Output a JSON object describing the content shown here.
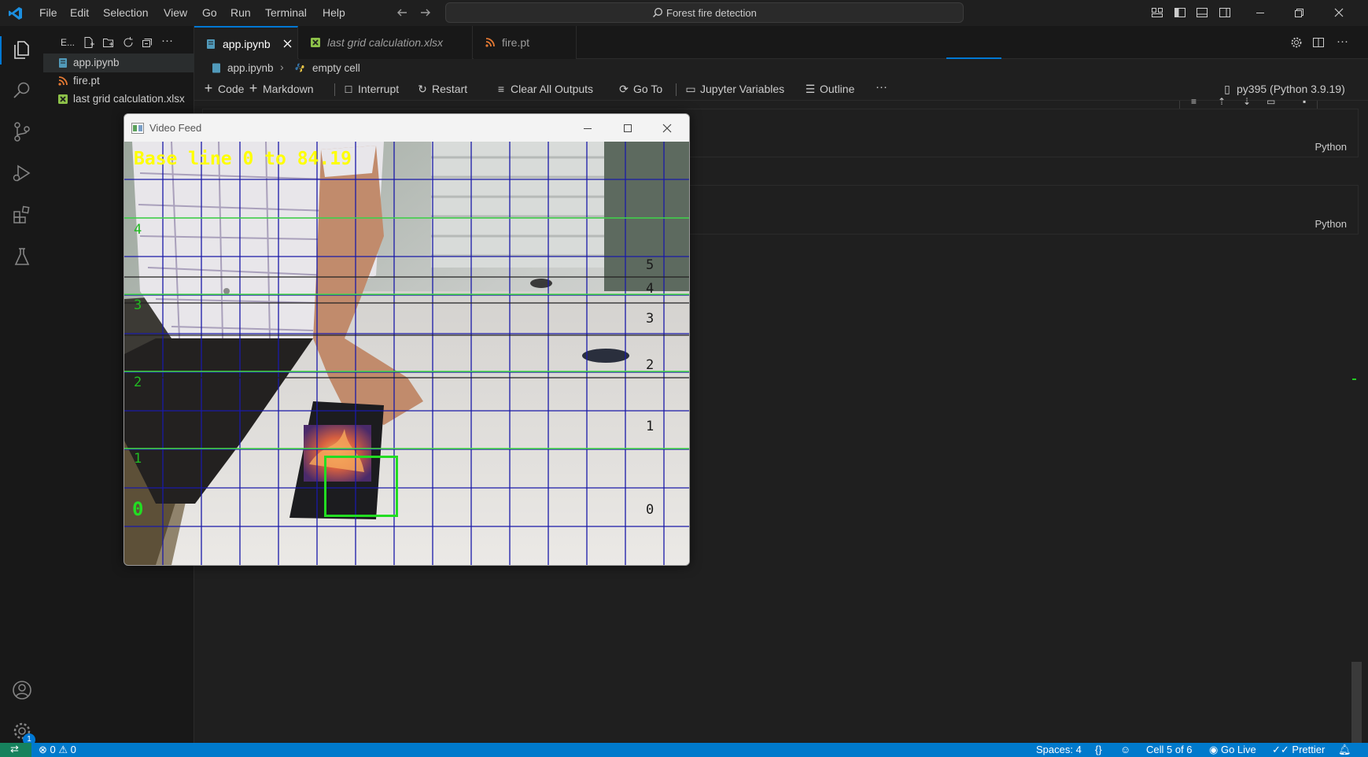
{
  "colors": {
    "accent": "#0078d4",
    "status_bar": "#007acc",
    "detect_box": "#22dd22",
    "overlay_text": "#ffff00"
  },
  "menu": [
    "File",
    "Edit",
    "Selection",
    "View",
    "Go",
    "Run",
    "Terminal",
    "Help"
  ],
  "search": {
    "text": "Forest fire detection",
    "icon": "search-icon"
  },
  "explorer": {
    "title": "E...",
    "files": [
      {
        "name": "app.ipynb",
        "icon": "notebook-icon"
      },
      {
        "name": "fire.pt",
        "icon": "rss-file-icon"
      },
      {
        "name": "last grid calculation.xlsx",
        "icon": "excel-icon"
      }
    ]
  },
  "tabs": [
    {
      "label": "app.ipynb",
      "icon": "notebook-icon",
      "active": true
    },
    {
      "label": "last grid calculation.xlsx",
      "icon": "excel-icon",
      "active": false
    },
    {
      "label": "fire.pt",
      "icon": "rss-file-icon",
      "active": false
    }
  ],
  "breadcrumb": {
    "file": "app.ipynb",
    "cell": "empty cell"
  },
  "notebook_toolbar": {
    "code": "Code",
    "markdown": "Markdown",
    "interrupt": "Interrupt",
    "restart": "Restart",
    "clear": "Clear All Outputs",
    "goto": "Go To",
    "variables": "Jupyter Variables",
    "outline": "Outline",
    "more": "···",
    "kernel": "py395 (Python 3.9.19)"
  },
  "cells": [
    {
      "lang": "Python"
    },
    {
      "lang": "Python"
    }
  ],
  "video_window": {
    "title": "Video Feed",
    "overlay": "Base line 0 to 84.19",
    "left_labels": [
      "4",
      "3",
      "2",
      "1",
      "0"
    ],
    "right_labels": [
      "5",
      "4",
      "3",
      "2",
      "1",
      "0"
    ]
  },
  "status": {
    "errors": "0",
    "warnings": "0",
    "spaces": "Spaces: 4",
    "braces": "{}",
    "cell": "Cell 5 of 6",
    "golive": "Go Live",
    "prettier": "Prettier",
    "badge": "1"
  }
}
